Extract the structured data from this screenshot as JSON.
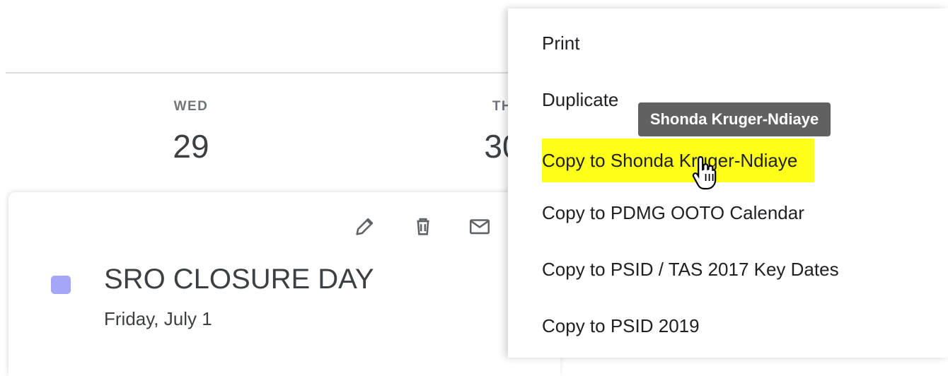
{
  "calendar": {
    "days": [
      {
        "dow": "WED",
        "date": "29"
      },
      {
        "dow": "TH",
        "date": "30"
      }
    ]
  },
  "event": {
    "title": "SRO CLOSURE DAY",
    "date": "Friday, July 1",
    "color": "#a6a6f7",
    "actions": [
      "pencil-icon",
      "trash-icon",
      "mail-icon"
    ]
  },
  "menu": {
    "items": [
      {
        "label": "Print"
      },
      {
        "label": "Duplicate"
      },
      {
        "label": "Copy to Shonda Kruger-Ndiaye",
        "highlighted": true
      },
      {
        "label": "Copy to PDMG OOTO Calendar"
      },
      {
        "label": "Copy to PSID / TAS 2017 Key Dates"
      },
      {
        "label": "Copy to PSID 2019"
      }
    ]
  },
  "tooltip": {
    "text": "Shonda Kruger-Ndiaye"
  },
  "colors": {
    "highlight": "#ffff19",
    "tooltip_bg": "#616161"
  }
}
